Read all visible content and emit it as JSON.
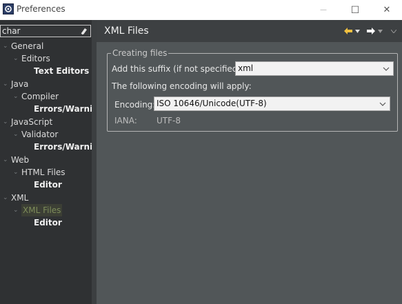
{
  "window": {
    "title": "Preferences",
    "controls": {
      "minimize": "—",
      "maximize": "☐",
      "close": "✕"
    }
  },
  "filter": {
    "value": "char"
  },
  "tree": [
    {
      "label": "General",
      "expanded": true
    },
    {
      "label": "Editors",
      "expanded": true
    },
    {
      "label": "Text Editors"
    },
    {
      "label": "Java",
      "expanded": true
    },
    {
      "label": "Compiler",
      "expanded": true
    },
    {
      "label": "Errors/Warnings"
    },
    {
      "label": "JavaScript",
      "expanded": true
    },
    {
      "label": "Validator",
      "expanded": true
    },
    {
      "label": "Errors/Warnings"
    },
    {
      "label": "Web",
      "expanded": true
    },
    {
      "label": "HTML Files",
      "expanded": true
    },
    {
      "label": "Editor"
    },
    {
      "label": "XML",
      "expanded": true
    },
    {
      "label": "XML Files",
      "expanded": true,
      "selected": true
    },
    {
      "label": "Editor"
    }
  ],
  "page": {
    "title": "XML Files",
    "group_title": "Creating files",
    "suffix_label": "Add this suffix (if not specified):",
    "suffix_value": "xml",
    "encoding_note": "The following encoding will apply:",
    "encoding_label": "Encoding:",
    "encoding_value": "ISO 10646/Unicode(UTF-8)",
    "iana_label": "IANA:",
    "iana_value": "UTF-8"
  },
  "colors": {
    "selection_text": "#7d8c5a",
    "nav_back_arrow": "#f0c040",
    "nav_forward_arrow": "#ffffff"
  }
}
